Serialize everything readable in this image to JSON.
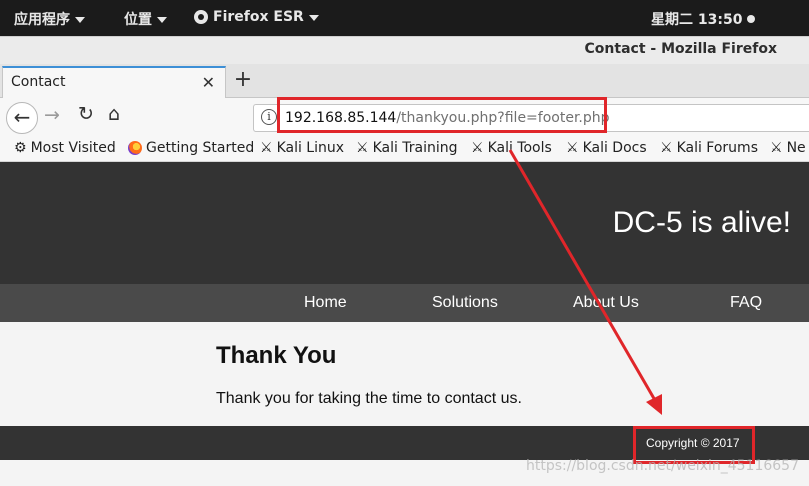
{
  "system_bar": {
    "applications": "应用程序",
    "places": "位置",
    "firefox_menu": "Firefox ESR",
    "clock": "星期二 13:50"
  },
  "window": {
    "title": "Contact - Mozilla Firefox"
  },
  "tabs": [
    {
      "label": "Contact",
      "active": true
    }
  ],
  "new_tab": "+",
  "toolbar": {
    "back": "←",
    "forward": "→",
    "reload": "↻",
    "home": "⌂"
  },
  "url": {
    "host": "192.168.85.144",
    "path": "/thankyou.php?file=footer.php"
  },
  "bookmarks": [
    {
      "label": "Most Visited",
      "icon": "gear-icon"
    },
    {
      "label": "Getting Started",
      "icon": "firefox-icon"
    },
    {
      "label": "Kali Linux",
      "icon": "kali-dragon-icon"
    },
    {
      "label": "Kali Training",
      "icon": "kali-dragon-icon"
    },
    {
      "label": "Kali Tools",
      "icon": "kali-dragon-icon"
    },
    {
      "label": "Kali Docs",
      "icon": "kali-dragon-icon"
    },
    {
      "label": "Kali Forums",
      "icon": "kali-dragon-icon"
    },
    {
      "label": "Ne",
      "icon": "kali-dragon-icon"
    }
  ],
  "site": {
    "title": "DC-5 is alive!",
    "nav": [
      "Home",
      "Solutions",
      "About Us",
      "FAQ"
    ],
    "heading": "Thank You",
    "message": "Thank you for taking the time to contact us.",
    "copyright": "Copyright © 2017"
  },
  "watermark": "https://blog.csdn.net/weixin_45116657",
  "colors": {
    "annotation_red": "#e0262a",
    "site_header": "#333333",
    "site_nav": "#4a4a4a",
    "tab_accent": "#3d8fd6"
  }
}
